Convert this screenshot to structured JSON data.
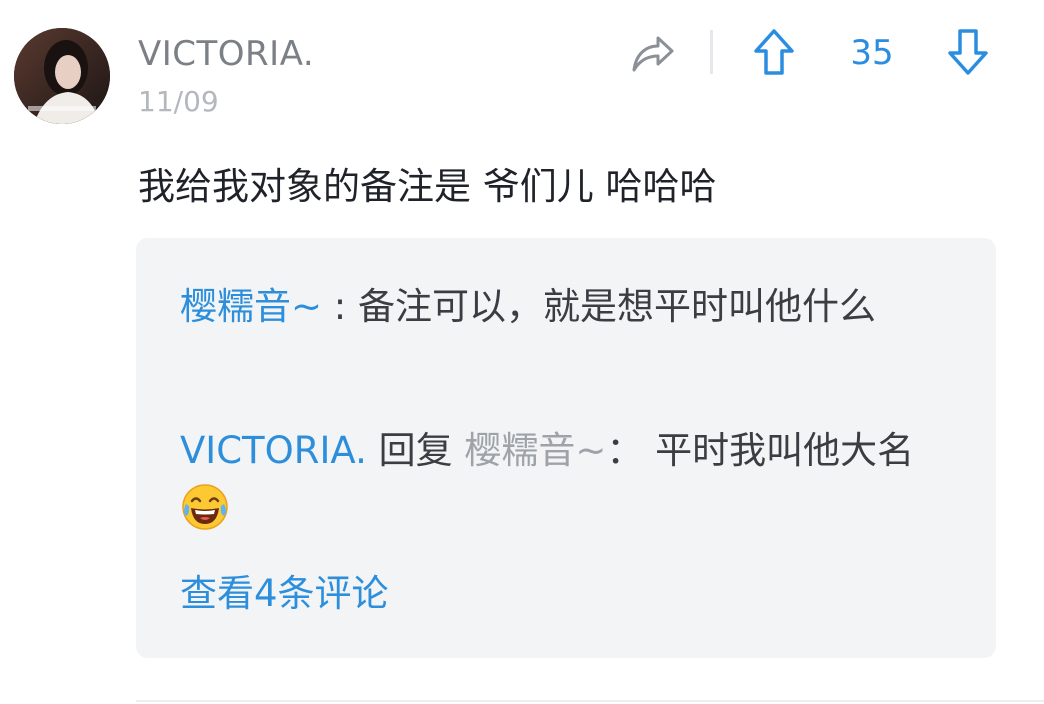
{
  "post": {
    "username": "VICTORIA.",
    "date": "11/09",
    "content": "我给我对象的备注是 爷们儿 哈哈哈",
    "vote_count": "35"
  },
  "icons": {
    "share": "share-icon",
    "upvote": "arrow-up-icon",
    "downvote": "arrow-down-icon",
    "emoji": "laughing-tears-emoji-icon"
  },
  "replies": [
    {
      "author": "樱糯音~",
      "separator": " : ",
      "text": "备注可以，就是想平时叫他什么"
    },
    {
      "author": "VICTORIA.",
      "reply_word": " 回复 ",
      "reply_to": "樱糯音~",
      "separator": "： ",
      "text": "平时我叫他大名"
    }
  ],
  "view_more": "查看4条评论",
  "colors": {
    "accent": "#2d8fdc",
    "username": "#7b7f86",
    "date": "#b4b8be",
    "reply_bg": "#f3f4f6",
    "text": "#1f2329"
  }
}
